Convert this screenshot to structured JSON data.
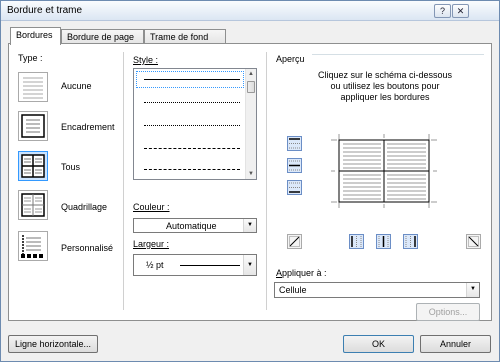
{
  "window": {
    "title": "Bordure et trame",
    "help_label": "?",
    "close_label": "✕"
  },
  "tabs": [
    {
      "label": "Bordures"
    },
    {
      "label": "Bordure de page"
    },
    {
      "label": "Trame de fond"
    }
  ],
  "type": {
    "heading": "Type :",
    "options": [
      {
        "label": "Aucune",
        "icon": "none-border-icon"
      },
      {
        "label": "Encadrement",
        "icon": "box-border-icon"
      },
      {
        "label": "Tous",
        "icon": "all-borders-icon",
        "selected": true
      },
      {
        "label": "Quadrillage",
        "icon": "grid-border-icon"
      },
      {
        "label": "Personnalisé",
        "icon": "custom-border-icon"
      }
    ]
  },
  "style": {
    "heading": "Style :",
    "options": [
      "solid",
      "dotted",
      "dashed",
      "dash-dot"
    ]
  },
  "color": {
    "label": "Couleur :",
    "value": "Automatique"
  },
  "width": {
    "label": "Largeur :",
    "value": "½ pt"
  },
  "preview": {
    "heading": "Aperçu",
    "instructions": "Cliquez sur le schéma ci-dessous\nou utilisez les boutons pour\nappliquer les bordures"
  },
  "apply": {
    "label": "Appliquer à :",
    "value": "Cellule"
  },
  "buttons": {
    "options": "Options...",
    "horizontal_line": "Ligne horizontale...",
    "ok": "OK",
    "cancel": "Annuler"
  },
  "colors": {
    "selection": "#cce4ff",
    "selection_border": "#3399ff",
    "border_button": "#dbe8fa"
  }
}
